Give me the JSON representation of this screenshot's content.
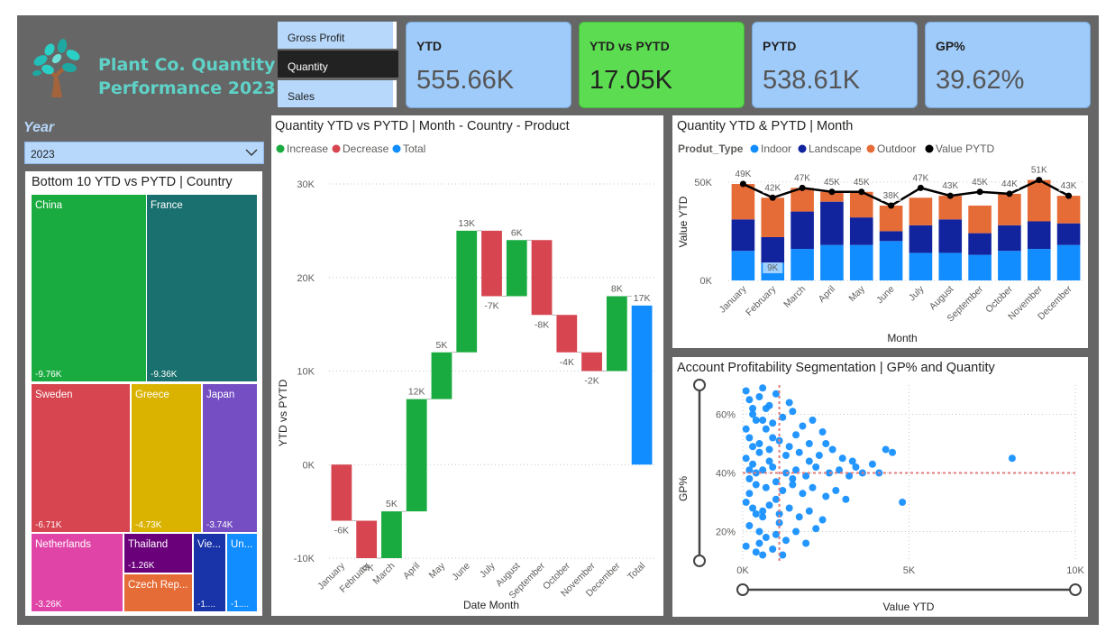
{
  "header": {
    "title_line1": "Plant Co. Quantity",
    "title_line2": "Performance 2023"
  },
  "measures": [
    {
      "label": "Gross Profit",
      "active": false
    },
    {
      "label": "Quantity",
      "active": true
    },
    {
      "label": "Sales",
      "active": false
    }
  ],
  "kpis": [
    {
      "label": "YTD",
      "value": "555.66K",
      "color": "#9fcbfa"
    },
    {
      "label": "YTD vs PYTD",
      "value": "17.05K",
      "color": "#5cdc50"
    },
    {
      "label": "PYTD",
      "value": "538.61K",
      "color": "#9fcbfa"
    },
    {
      "label": "GP%",
      "value": "39.62%",
      "color": "#9fcbfa"
    }
  ],
  "year_slicer": {
    "label": "Year",
    "selected": "2023"
  },
  "treemap": {
    "title": "Bottom 10 YTD vs PYTD | Country",
    "cells": [
      {
        "name": "China",
        "value": "-9.76K",
        "color": "#1aab40"
      },
      {
        "name": "France",
        "value": "-9.36K",
        "color": "#19706e"
      },
      {
        "name": "Sweden",
        "value": "-6.71K",
        "color": "#d64550"
      },
      {
        "name": "Greece",
        "value": "-4.73K",
        "color": "#d9b300"
      },
      {
        "name": "Japan",
        "value": "-3.74K",
        "color": "#744ec2"
      },
      {
        "name": "Netherlands",
        "value": "-3.26K",
        "color": "#e044a7"
      },
      {
        "name": "Thailand",
        "value": "-1.26K",
        "color": "#6b007b"
      },
      {
        "name": "Czech Rep...",
        "value": "",
        "color": "#e66c37"
      },
      {
        "name": "Vie...",
        "value": "-1....",
        "color": "#1834a8"
      },
      {
        "name": "Un...",
        "value": "-1....",
        "color": "#118dff"
      }
    ]
  },
  "waterfall_panel": {
    "title": "Quantity YTD vs PYTD | Month - Country - Product",
    "legend": [
      {
        "name": "Increase",
        "color": "#1aab40"
      },
      {
        "name": "Decrease",
        "color": "#d64550"
      },
      {
        "name": "Total",
        "color": "#118dff"
      }
    ],
    "ylabel": "YTD vs PYTD",
    "xlabel": "Date Month",
    "ytick_labels": [
      "30K",
      "20K",
      "10K",
      "0K",
      "-10K"
    ]
  },
  "stacked_panel": {
    "title": "Quantity YTD & PYTD | Month",
    "legend_title": "Produt_Type",
    "legend": [
      {
        "name": "Indoor",
        "color": "#118dff"
      },
      {
        "name": "Landscape",
        "color": "#12239e"
      },
      {
        "name": "Outdoor",
        "color": "#e66c37"
      },
      {
        "name": "Value PYTD",
        "color": "#000000"
      }
    ],
    "ylabel": "Value YTD",
    "xlabel": "Month",
    "ytick_labels": [
      "50K",
      "0K"
    ]
  },
  "scatter_panel": {
    "title": "Account Profitability Segmentation | GP% and Quantity",
    "ylabel": "GP%",
    "xlabel": "Value YTD",
    "ytick_labels": [
      "60%",
      "40%",
      "20%"
    ],
    "xtick_labels": [
      "0K",
      "5K",
      "10K"
    ]
  },
  "chart_data": [
    {
      "type": "bar",
      "subtype": "waterfall",
      "categories": [
        "January",
        "February",
        "March",
        "April",
        "May",
        "June",
        "July",
        "August",
        "September",
        "October",
        "November",
        "December",
        "Total"
      ],
      "values": [
        -6,
        -4,
        5,
        12,
        5,
        13,
        -7,
        6,
        -8,
        -4,
        -2,
        8,
        17
      ],
      "labels": [
        "-6K",
        "-4K",
        "5K",
        "12K",
        "5K",
        "13K",
        "-7K",
        "6K",
        "-8K",
        "-4K",
        "-2K",
        "8K",
        "17K"
      ],
      "unit": "K",
      "ylim": [
        -10,
        30
      ],
      "yticks": [
        -10,
        0,
        10,
        20,
        30
      ],
      "grid": true
    },
    {
      "type": "bar",
      "subtype": "stacked-with-line",
      "categories": [
        "January",
        "February",
        "March",
        "April",
        "May",
        "June",
        "July",
        "August",
        "September",
        "October",
        "November",
        "December"
      ],
      "unit": "K",
      "ylim": [
        0,
        60
      ],
      "yticks": [
        0,
        50
      ],
      "series": [
        {
          "name": "Indoor",
          "values": [
            15,
            9,
            16,
            18,
            18,
            20,
            14,
            14,
            13,
            15,
            16,
            18
          ]
        },
        {
          "name": "Landscape",
          "values": [
            16,
            13,
            19,
            22,
            14,
            5,
            14,
            17,
            11,
            13,
            14,
            11
          ]
        },
        {
          "name": "Outdoor",
          "values": [
            18,
            20,
            12,
            5,
            13,
            13,
            14,
            12,
            14,
            16,
            21,
            14
          ]
        },
        {
          "name": "Value PYTD",
          "values": [
            49,
            42,
            47,
            45,
            45,
            38,
            47,
            43,
            45,
            44,
            51,
            43
          ]
        }
      ],
      "data_labels": [
        {
          "category": "January",
          "text": "49K"
        },
        {
          "category": "February",
          "text": "42K"
        },
        {
          "category": "February",
          "text": "9K"
        },
        {
          "category": "March",
          "text": "47K"
        },
        {
          "category": "April",
          "text": "45K"
        },
        {
          "category": "May",
          "text": "45K"
        },
        {
          "category": "June",
          "text": "38K"
        },
        {
          "category": "July",
          "text": "47K"
        },
        {
          "category": "August",
          "text": "43K"
        },
        {
          "category": "September",
          "text": "45K"
        },
        {
          "category": "October",
          "text": "44K"
        },
        {
          "category": "November",
          "text": "51K"
        },
        {
          "category": "December",
          "text": "43K"
        }
      ]
    },
    {
      "type": "scatter",
      "x_unit": "K",
      "xlim": [
        0,
        10
      ],
      "ylim": [
        10,
        70
      ],
      "xticks": [
        0,
        5,
        10
      ],
      "yticks": [
        20,
        40,
        60
      ],
      "reference_lines": {
        "x": 1.1,
        "y": 40
      },
      "color": "#118dff",
      "points": [
        [
          0.1,
          68
        ],
        [
          0.2,
          65
        ],
        [
          0.3,
          62
        ],
        [
          0.5,
          66
        ],
        [
          0.6,
          69
        ],
        [
          0.8,
          63
        ],
        [
          1.0,
          67
        ],
        [
          0.4,
          58
        ],
        [
          0.7,
          55
        ],
        [
          0.9,
          57
        ],
        [
          1.2,
          59
        ],
        [
          1.5,
          61
        ],
        [
          1.8,
          56
        ],
        [
          2.1,
          58
        ],
        [
          2.4,
          54
        ],
        [
          0.2,
          52
        ],
        [
          0.5,
          50
        ],
        [
          0.8,
          48
        ],
        [
          1.1,
          51
        ],
        [
          1.4,
          49
        ],
        [
          1.7,
          47
        ],
        [
          2.0,
          50
        ],
        [
          2.3,
          46
        ],
        [
          2.7,
          48
        ],
        [
          3.0,
          45
        ],
        [
          3.3,
          44
        ],
        [
          3.9,
          43
        ],
        [
          4.3,
          48
        ],
        [
          4.5,
          47
        ],
        [
          0.1,
          45
        ],
        [
          0.3,
          43
        ],
        [
          0.6,
          41
        ],
        [
          0.9,
          42
        ],
        [
          1.3,
          40
        ],
        [
          1.6,
          41
        ],
        [
          1.9,
          39
        ],
        [
          2.2,
          42
        ],
        [
          2.6,
          40
        ],
        [
          2.9,
          41
        ],
        [
          3.2,
          39
        ],
        [
          3.6,
          40
        ],
        [
          4.1,
          40
        ],
        [
          0.2,
          38
        ],
        [
          0.4,
          36
        ],
        [
          0.7,
          35
        ],
        [
          1.0,
          37
        ],
        [
          1.2,
          34
        ],
        [
          1.5,
          36
        ],
        [
          1.8,
          33
        ],
        [
          2.1,
          35
        ],
        [
          2.5,
          32
        ],
        [
          2.8,
          34
        ],
        [
          3.1,
          31
        ],
        [
          4.8,
          30
        ],
        [
          0.1,
          30
        ],
        [
          0.3,
          28
        ],
        [
          0.6,
          27
        ],
        [
          0.8,
          29
        ],
        [
          1.1,
          26
        ],
        [
          1.4,
          28
        ],
        [
          1.7,
          25
        ],
        [
          2.0,
          27
        ],
        [
          2.4,
          24
        ],
        [
          2.2,
          21
        ],
        [
          0.2,
          22
        ],
        [
          0.5,
          20
        ],
        [
          0.7,
          18
        ],
        [
          1.0,
          19
        ],
        [
          1.3,
          17
        ],
        [
          1.6,
          20
        ],
        [
          1.9,
          16
        ],
        [
          0.1,
          15
        ],
        [
          0.4,
          13
        ],
        [
          0.6,
          12
        ],
        [
          0.9,
          14
        ],
        [
          1.2,
          12
        ],
        [
          8.1,
          45
        ],
        [
          0.3,
          60
        ],
        [
          0.5,
          47
        ],
        [
          0.2,
          33
        ],
        [
          0.6,
          25
        ],
        [
          1.0,
          31
        ],
        [
          0.4,
          40
        ],
        [
          0.8,
          44
        ],
        [
          1.3,
          46
        ],
        [
          0.1,
          55
        ],
        [
          0.7,
          62
        ],
        [
          1.6,
          53
        ],
        [
          2.5,
          50
        ],
        [
          3.4,
          42
        ],
        [
          0.5,
          16
        ],
        [
          1.1,
          23
        ],
        [
          0.9,
          52
        ],
        [
          0.3,
          49
        ],
        [
          1.5,
          38
        ],
        [
          2.0,
          44
        ],
        [
          0.2,
          41
        ],
        [
          0.6,
          58
        ],
        [
          1.4,
          64
        ],
        [
          0.4,
          26
        ]
      ]
    }
  ]
}
